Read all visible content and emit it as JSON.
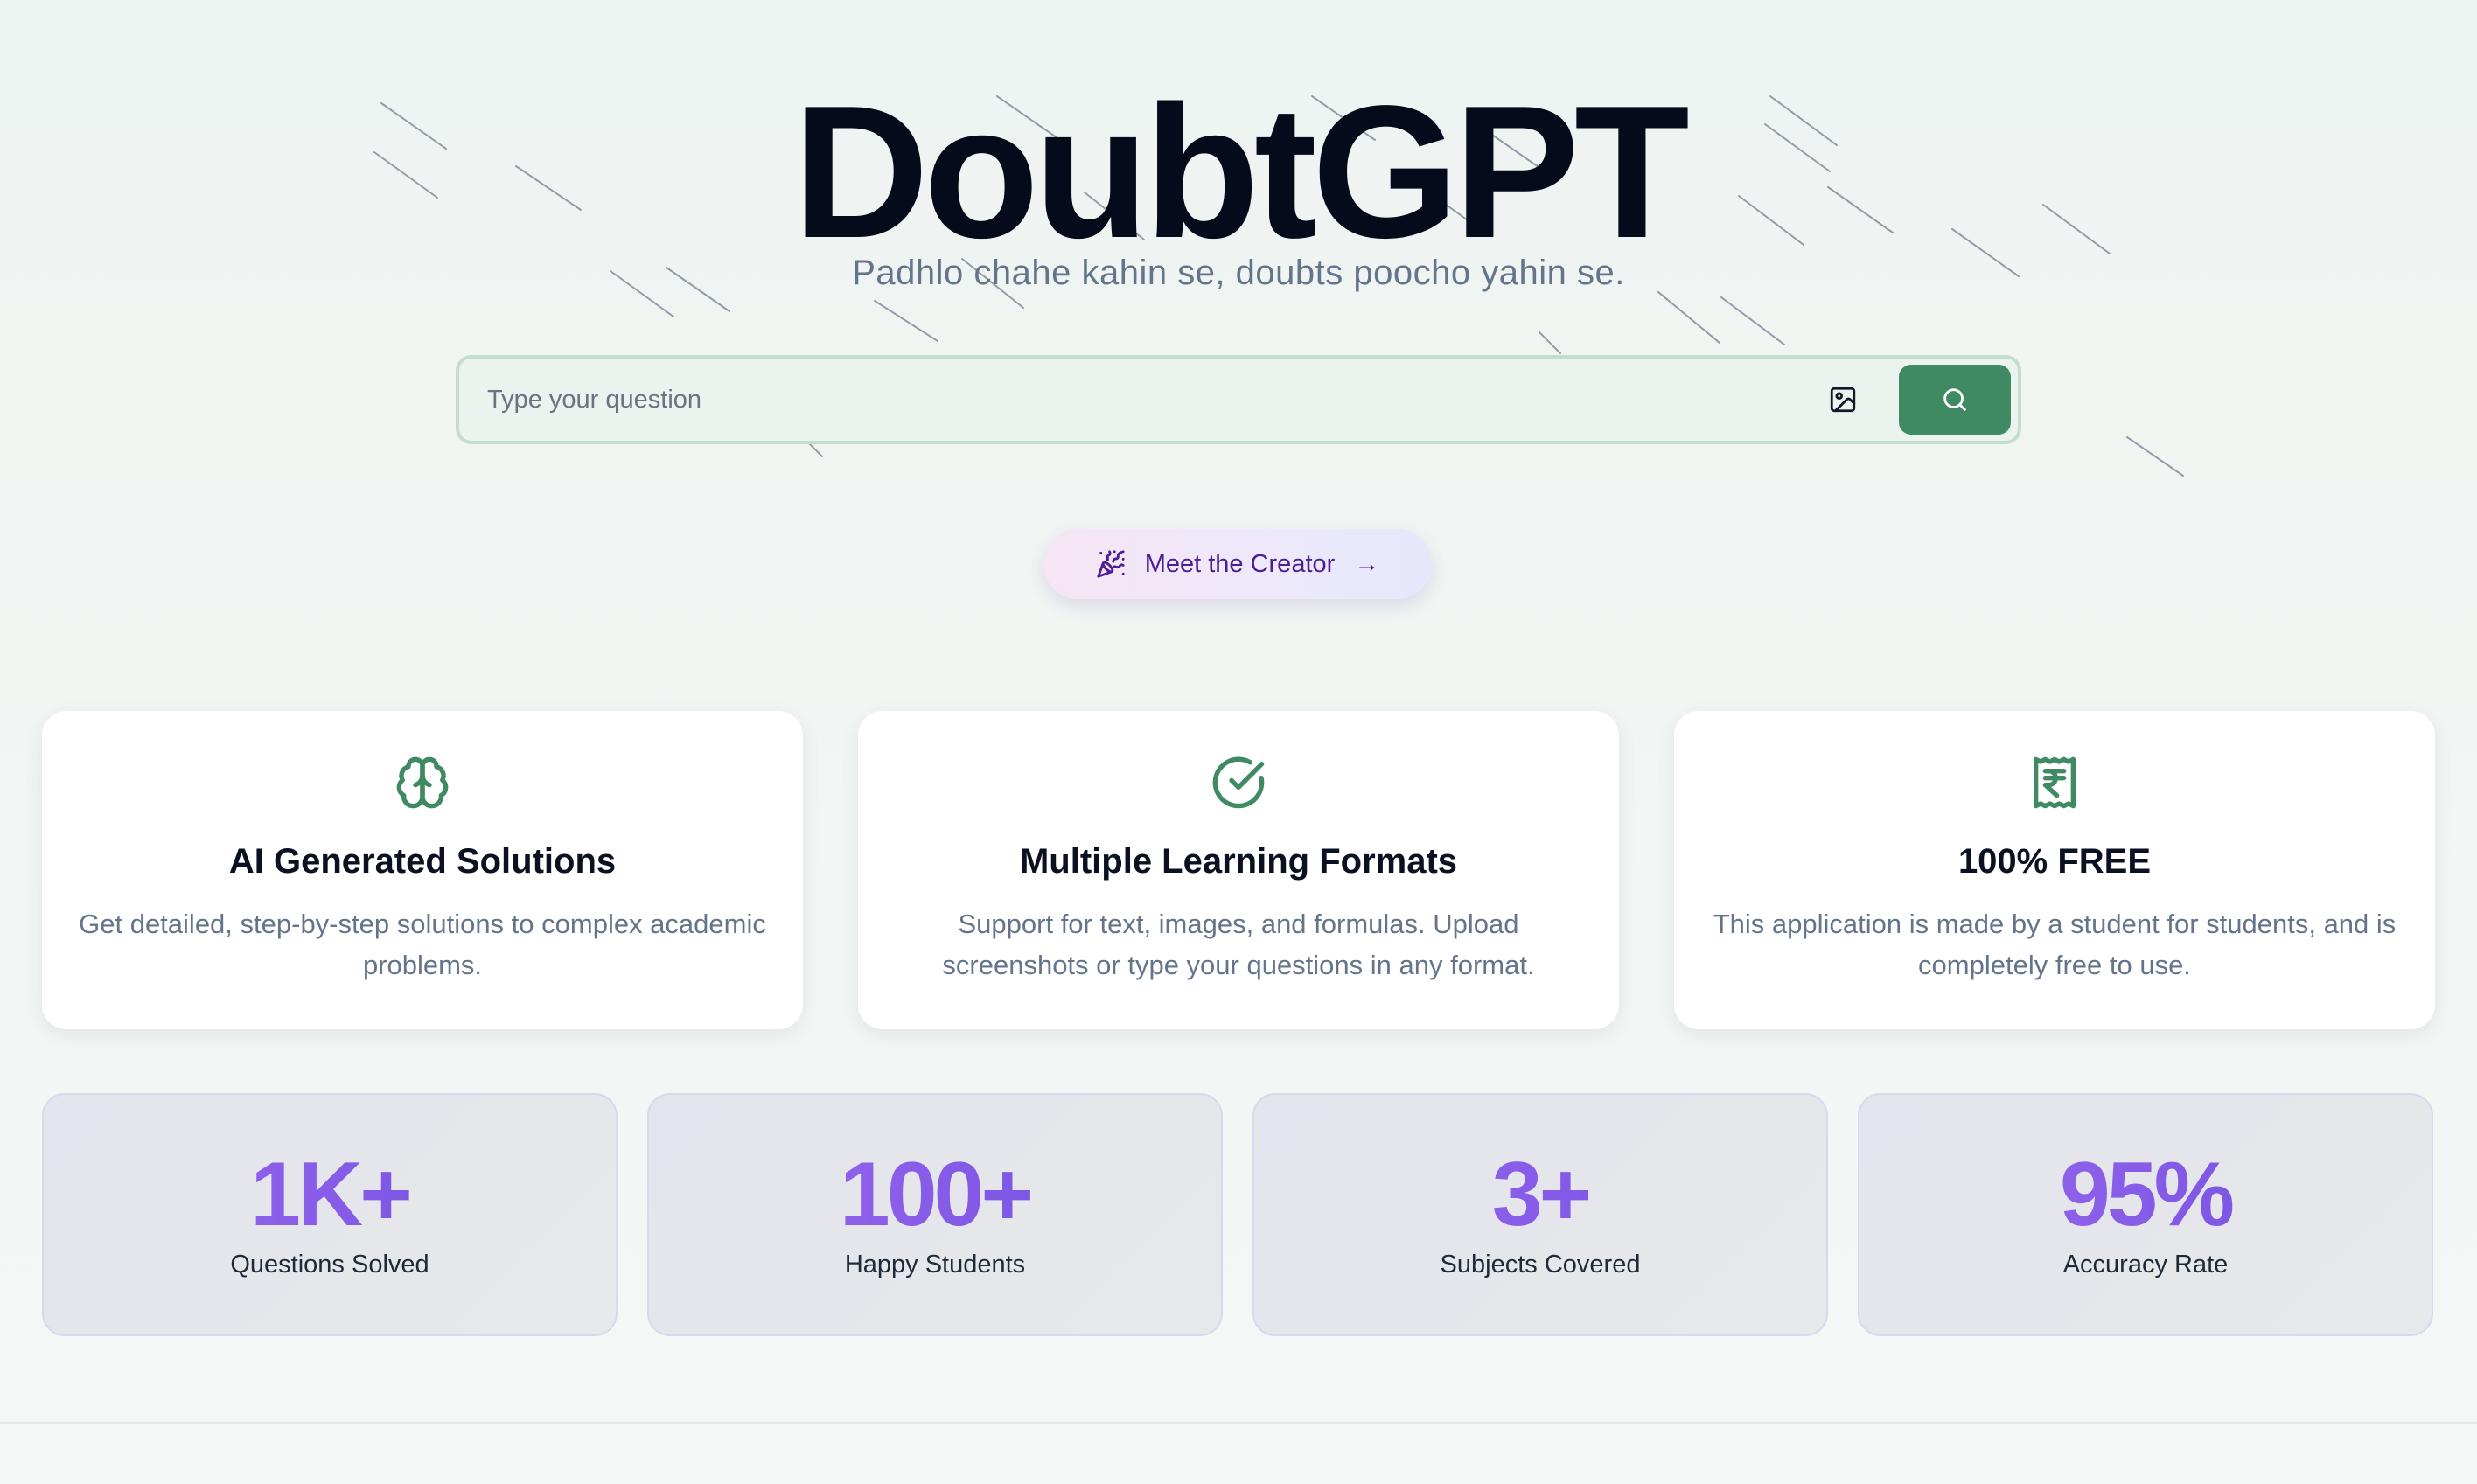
{
  "hero": {
    "title": "DoubtGPT",
    "subtitle": "Padhlo chahe kahin se, doubts poocho yahin se."
  },
  "search": {
    "placeholder": "Type your question",
    "image_icon": "image-upload-icon",
    "search_icon": "search-icon",
    "accent": "#3f8a62"
  },
  "creator_button": {
    "label": "Meet the Creator",
    "arrow": "→",
    "icon": "party-popper-icon"
  },
  "features": [
    {
      "icon": "brain-icon",
      "title": "AI Generated Solutions",
      "description": "Get detailed, step-by-step solutions to complex academic problems."
    },
    {
      "icon": "check-circle-icon",
      "title": "Multiple Learning Formats",
      "description": "Support for text, images, and formulas. Upload screenshots or type your questions in any format."
    },
    {
      "icon": "rupee-receipt-icon",
      "title": "100% FREE",
      "description": "This application is made by a student for students, and is completely free to use."
    }
  ],
  "stats": [
    {
      "value": "1K+",
      "label": "Questions Solved"
    },
    {
      "value": "100+",
      "label": "Happy Students"
    },
    {
      "value": "3+",
      "label": "Subjects Covered"
    },
    {
      "value": "95%",
      "label": "Accuracy Rate"
    }
  ],
  "colors": {
    "brand_green": "#3f8a62",
    "stat_gradient_start": "#a26bf0",
    "stat_gradient_end": "#6a4cdf"
  }
}
